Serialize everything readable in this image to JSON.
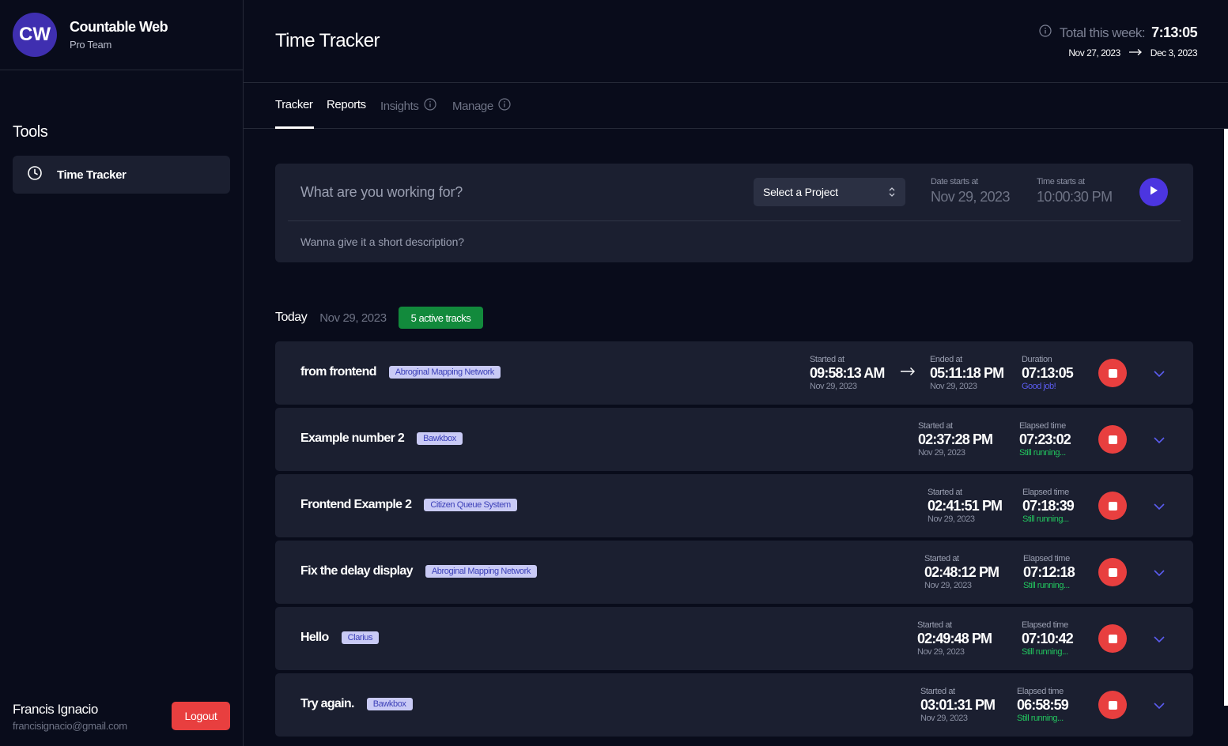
{
  "brand": {
    "initials": "CW",
    "name": "Countable Web",
    "team": "Pro Team"
  },
  "sidebar": {
    "section_title": "Tools",
    "items": [
      {
        "label": "Time Tracker",
        "icon": "clock-icon",
        "active": true
      }
    ]
  },
  "user": {
    "name": "Francis Ignacio",
    "email": "francisignacio@gmail.com",
    "logout_label": "Logout"
  },
  "header": {
    "title": "Time Tracker",
    "week_label": "Total this week:",
    "week_total": "7:13:05",
    "range_start": "Nov 27, 2023",
    "range_end": "Dec 3, 2023"
  },
  "tabs": [
    {
      "label": "Tracker",
      "active": true
    },
    {
      "label": "Reports",
      "active": false
    },
    {
      "label": "Insights",
      "disabled": true
    },
    {
      "label": "Manage",
      "disabled": true
    }
  ],
  "entry": {
    "placeholder": "What are you working for?",
    "project_select": "Select a Project",
    "date_label": "Date starts at",
    "date_value": "Nov 29, 2023",
    "time_label": "Time starts at",
    "time_value": "10:00:30 PM",
    "desc_placeholder": "Wanna give it a short description?"
  },
  "today": {
    "label": "Today",
    "date": "Nov 29, 2023",
    "badge": "5 active tracks"
  },
  "tracks": [
    {
      "name": "from frontend",
      "tag": "Abroginal Mapping Network",
      "started_label": "Started at",
      "started_time": "09:58:13 AM",
      "started_date": "Nov 29, 2023",
      "ended_label": "Ended at",
      "ended_time": "05:11:18 PM",
      "ended_date": "Nov 29, 2023",
      "right_label": "Duration",
      "right_value": "07:13:05",
      "right_status": "Good job!"
    },
    {
      "name": "Example number 2",
      "tag": "Bawkbox",
      "started_label": "Started at",
      "started_time": "02:37:28 PM",
      "started_date": "Nov 29, 2023",
      "right_label": "Elapsed time",
      "right_value": "07:23:02",
      "right_status": "Still running..."
    },
    {
      "name": "Frontend Example 2",
      "tag": "Citizen Queue System",
      "started_label": "Started at",
      "started_time": "02:41:51 PM",
      "started_date": "Nov 29, 2023",
      "right_label": "Elapsed time",
      "right_value": "07:18:39",
      "right_status": "Still running..."
    },
    {
      "name": "Fix the delay display",
      "tag": "Abroginal Mapping Network",
      "started_label": "Started at",
      "started_time": "02:48:12 PM",
      "started_date": "Nov 29, 2023",
      "right_label": "Elapsed time",
      "right_value": "07:12:18",
      "right_status": "Still running..."
    },
    {
      "name": "Hello",
      "tag": "Clarius",
      "started_label": "Started at",
      "started_time": "02:49:48 PM",
      "started_date": "Nov 29, 2023",
      "right_label": "Elapsed time",
      "right_value": "07:10:42",
      "right_status": "Still running..."
    },
    {
      "name": "Try again.",
      "tag": "Bawkbox",
      "started_label": "Started at",
      "started_time": "03:01:31 PM",
      "started_date": "Nov 29, 2023",
      "right_label": "Elapsed time",
      "right_value": "06:58:59",
      "right_status": "Still running..."
    }
  ],
  "colors": {
    "background": "#090c1b",
    "panel": "#1b1f30",
    "accent": "#4c35e0",
    "danger": "#e83f3f",
    "success": "#128a3c",
    "running": "#22c55e",
    "tag_bg": "#c9caf5"
  }
}
